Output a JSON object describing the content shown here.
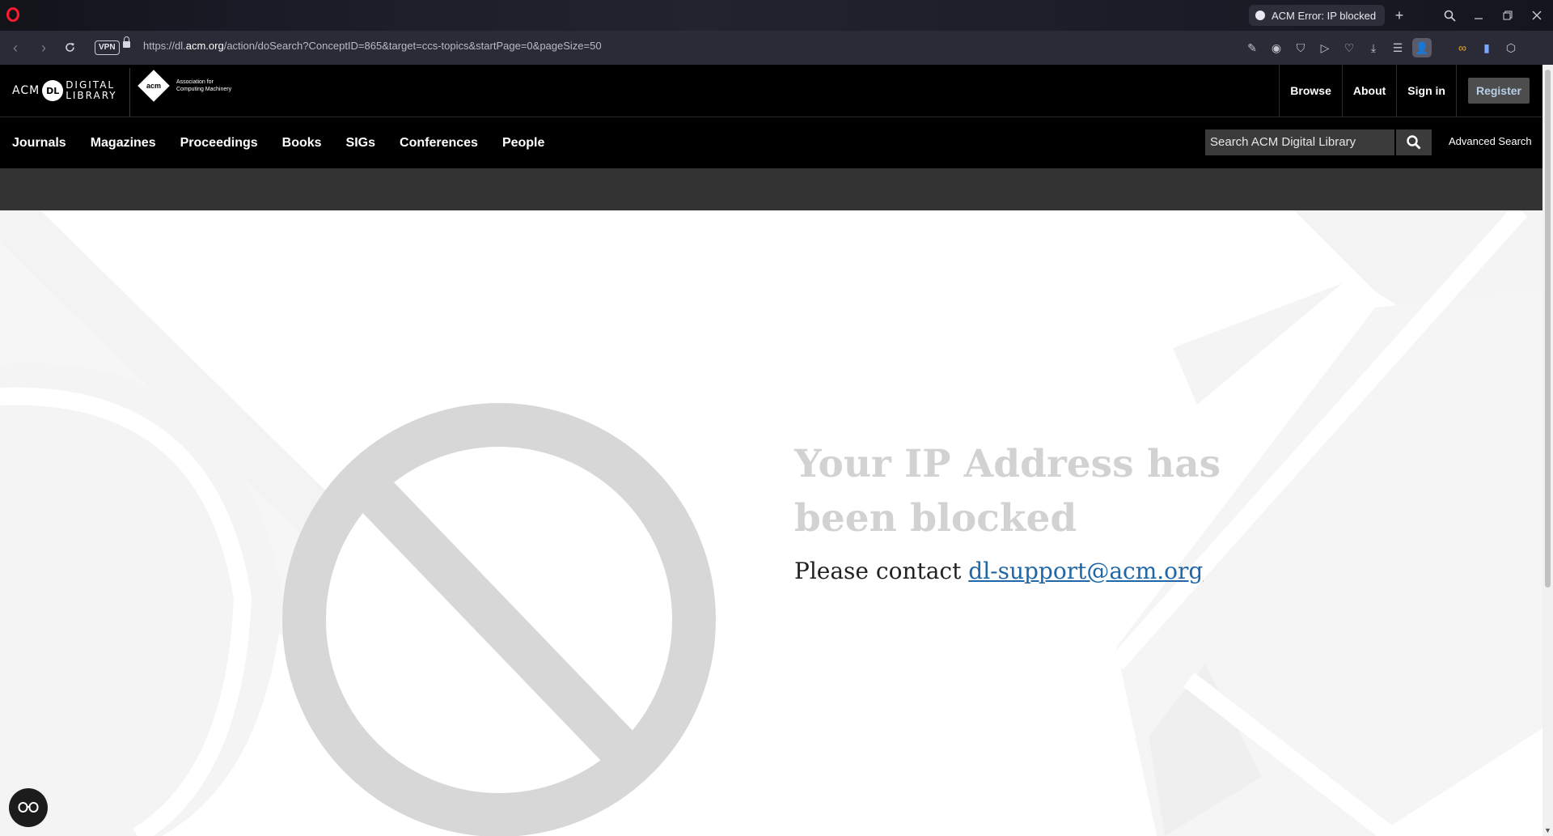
{
  "browser": {
    "tab_title": "ACM Error: IP blocked",
    "vpn_label": "VPN",
    "url_prefix": "https://dl.",
    "url_host": "acm.org",
    "url_path": "/action/doSearch?ConceptID=865&target=ccs-topics&startPage=0&pageSize=50"
  },
  "header": {
    "logo_acm": "ACM",
    "logo_dl_badge": "DL",
    "logo_digital": "DIGITAL",
    "logo_library": "LIBRARY",
    "logo_acm_short": "acm",
    "logo_assoc_line1": "Association for",
    "logo_assoc_line2": "Computing Machinery",
    "links": [
      "Browse",
      "About",
      "Sign in"
    ],
    "register_label": "Register"
  },
  "nav": {
    "items": [
      "Journals",
      "Magazines",
      "Proceedings",
      "Books",
      "SIGs",
      "Conferences",
      "People"
    ],
    "search_placeholder": "Search ACM Digital Library",
    "advanced_search": "Advanced Search"
  },
  "error": {
    "heading": "Your IP Address has been blocked",
    "contact_prefix": "Please contact",
    "contact_email": "dl-support@acm.org"
  },
  "colors": {
    "heading": "#d2d2d2",
    "link": "#1f67a6",
    "register_text": "#b8cde8",
    "opera_red": "#ff1b2d"
  }
}
